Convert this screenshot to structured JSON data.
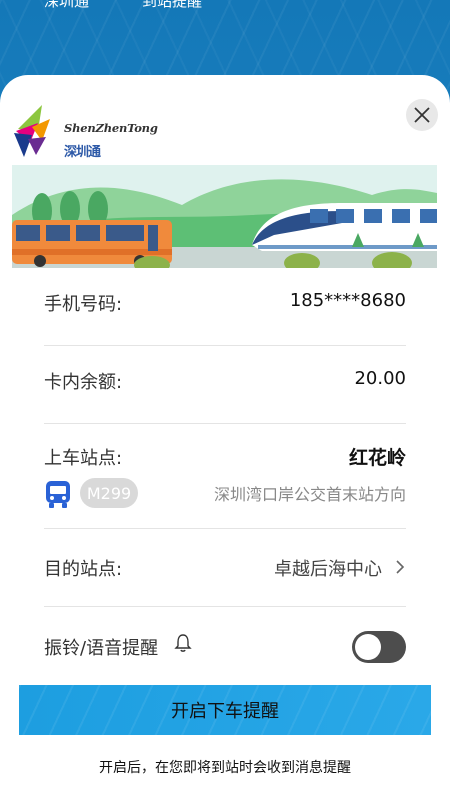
{
  "top_tabs": [
    "深圳通",
    "到站提醒"
  ],
  "logo": {
    "name_en": "ShenZhenTong",
    "name_cn": "深圳通"
  },
  "rows": {
    "phone": {
      "label": "手机号码:",
      "value": "185****8680"
    },
    "balance": {
      "label": "卡内余额:",
      "value": "20.00"
    },
    "boarding": {
      "label": "上车站点:",
      "station": "红花岭",
      "route": "M299",
      "direction": "深圳湾口岸公交首末站方向"
    },
    "destination": {
      "label": "目的站点:",
      "value": "卓越后海中心"
    },
    "alert": {
      "label": "振铃/语音提醒",
      "toggle_on": false
    }
  },
  "cta_label": "开启下车提醒",
  "hint": "开启后，在您即将到站时会收到消息提醒",
  "colors": {
    "accent": "#1d9ee0",
    "bus_icon": "#2a62d6",
    "toggle_off": "#4d4d4d"
  },
  "icons": [
    "close-icon",
    "bus-icon",
    "chevron-right-icon",
    "bell-icon"
  ]
}
